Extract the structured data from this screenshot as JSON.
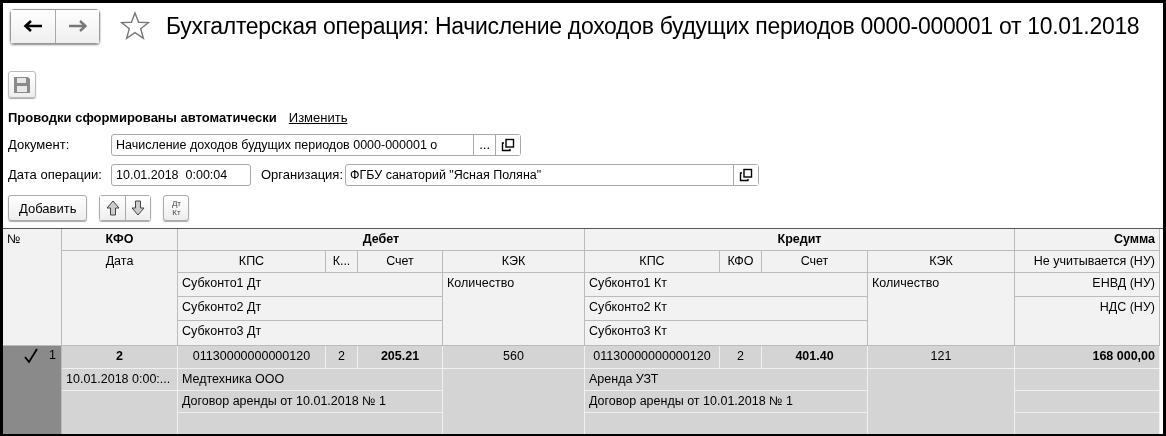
{
  "window": {
    "title": "Бухгалтерская операция: Начисление доходов будущих периодов 0000-000001 от 10.01.2018",
    "favorite": false
  },
  "save_button": {
    "disabled": true
  },
  "posting_status": {
    "text": "Проводки сформированы автоматически",
    "link": "Изменить"
  },
  "fields": [
    {
      "label": "Документ:",
      "value": "Начисление доходов будущих периодов 0000-000001 о",
      "choose_button": "..."
    },
    {
      "label": "Дата операции:",
      "value": "10.01.2018  0:00:04"
    },
    {
      "label": "Организация:",
      "value": "ФГБУ санаторий \"Ясная Поляна\""
    }
  ],
  "toolbar": {
    "add": "Добавить",
    "swap_top": "Дт",
    "swap_bottom": "Кт"
  },
  "table": {
    "header": {
      "number": "№",
      "kfo": "КФО",
      "date": "Дата",
      "debit": {
        "title": "Дебет",
        "kps": "КПС",
        "kfo": "К...",
        "account": "Счет",
        "kek": "КЭК",
        "subconto": [
          "Субконто1 Дт",
          "Субконто2 Дт",
          "Субконто3 Дт"
        ],
        "quantity": "Количество"
      },
      "credit": {
        "title": "Кредит",
        "kps": "КПС",
        "kfo": "КФО",
        "account": "Счет",
        "kek": "КЭК",
        "subconto": [
          "Субконто1 Кт",
          "Субконто2 Кт",
          "Субконто3 Кт"
        ],
        "quantity": "Количество"
      },
      "sum": {
        "title": "Сумма",
        "lines": [
          "Не учитывается (НУ)",
          "ЕНВД (НУ)",
          "НДС (НУ)"
        ]
      }
    },
    "rows": [
      {
        "selected": true,
        "active": true,
        "number": "1",
        "kfo": "2",
        "date": "10.01.2018 0:00:...",
        "debit": {
          "kps": "01130000000000120",
          "kfo": "2",
          "account": "205.21",
          "kek": "560",
          "subconto": [
            "Медтехника ООО",
            "Договор аренды от 10.01.2018 № 1"
          ]
        },
        "credit": {
          "kps": "01130000000000120",
          "kfo": "2",
          "account": "401.40",
          "kek": "121",
          "subconto": [
            "Аренда УЗТ",
            "Договор аренды от 10.01.2018 № 1"
          ]
        },
        "sum": "168 000,00"
      }
    ]
  }
}
